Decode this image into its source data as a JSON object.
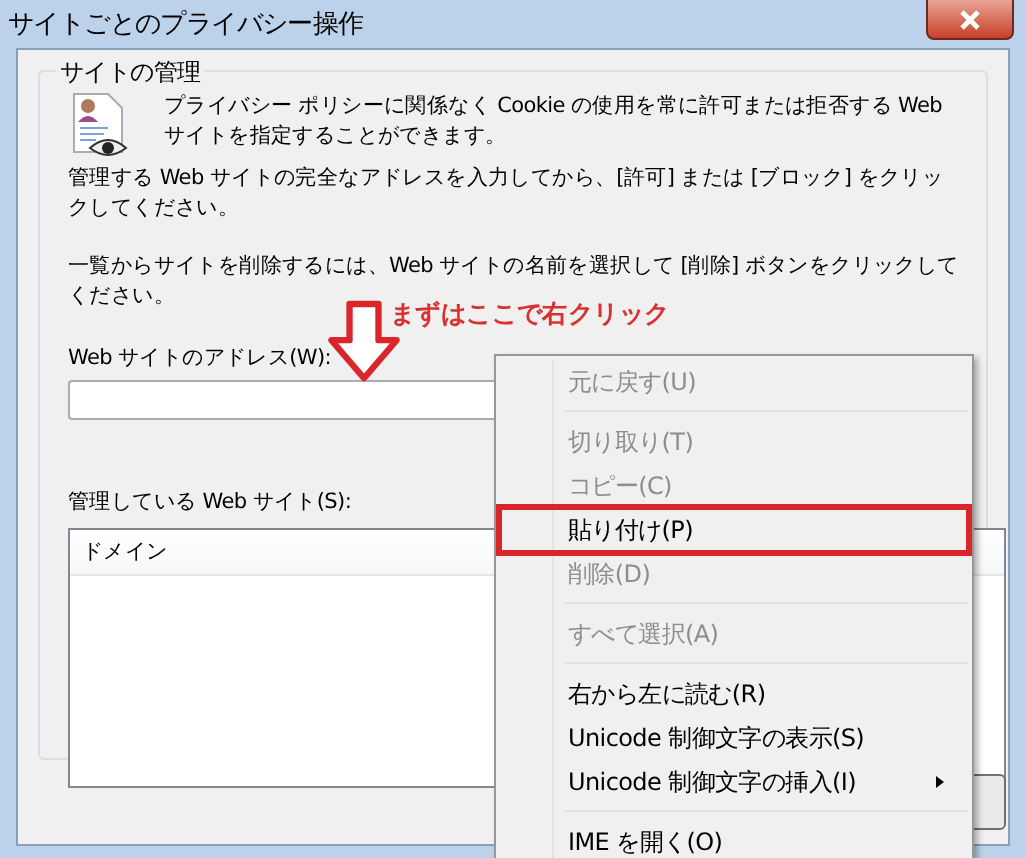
{
  "window": {
    "title": "サイトごとのプライバシー操作"
  },
  "group": {
    "title": "サイトの管理",
    "intro": "プライバシー ポリシーに関係なく Cookie の使用を常に許可または拒否する Web サイトを指定することができます。",
    "instruction": "管理する Web サイトの完全なアドレスを入力してから、[許可] または [ブロック] をクリックしてください。",
    "remove_hint": "一覧からサイトを削除するには、Web サイトの名前を選択して [削除] ボタンをクリックしてください。",
    "address_label": "Web サイトのアドレス(W):",
    "managed_label": "管理している Web サイト(S):",
    "table": {
      "columns": [
        "ドメイン"
      ]
    }
  },
  "annotation": {
    "text": "まずはここで右クリック"
  },
  "context_menu": [
    {
      "kind": "item",
      "label": "元に戻す(U)",
      "disabled": true,
      "highlighted": false
    },
    {
      "kind": "separator"
    },
    {
      "kind": "item",
      "label": "切り取り(T)",
      "disabled": true,
      "highlighted": false
    },
    {
      "kind": "item",
      "label": "コピー(C)",
      "disabled": true,
      "highlighted": false
    },
    {
      "kind": "item",
      "label": "貼り付け(P)",
      "disabled": false,
      "highlighted": true
    },
    {
      "kind": "item",
      "label": "削除(D)",
      "disabled": true,
      "highlighted": false
    },
    {
      "kind": "separator"
    },
    {
      "kind": "item",
      "label": "すべて選択(A)",
      "disabled": true,
      "highlighted": false
    },
    {
      "kind": "separator"
    },
    {
      "kind": "item",
      "label": "右から左に読む(R)",
      "disabled": false,
      "highlighted": false
    },
    {
      "kind": "item",
      "label": "Unicode 制御文字の表示(S)",
      "disabled": false,
      "highlighted": false
    },
    {
      "kind": "submenu",
      "label": "Unicode 制御文字の挿入(I)",
      "disabled": false,
      "highlighted": false
    },
    {
      "kind": "separator"
    },
    {
      "kind": "item",
      "label": "IME を開く(O)",
      "disabled": false,
      "highlighted": false
    }
  ]
}
